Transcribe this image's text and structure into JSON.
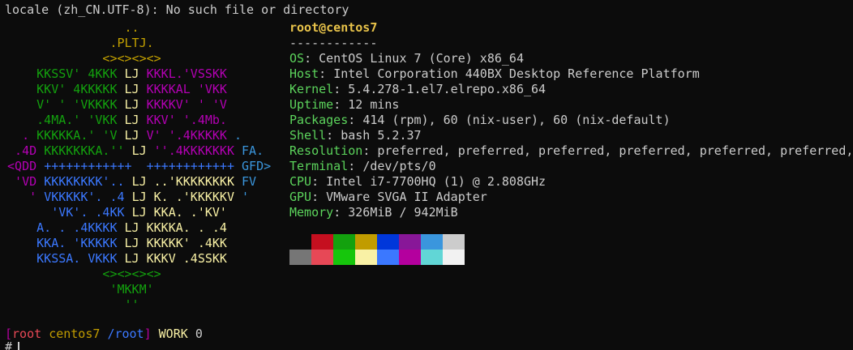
{
  "top_message": "locale (zh_CN.UTF-8): No such file or directory",
  "logo_rows": [
    [
      {
        "t": "                 ..",
        "c": "#c2a000"
      }
    ],
    [
      {
        "t": "               .PLTJ.",
        "c": "#c2a000"
      }
    ],
    [
      {
        "t": "              <><><><>",
        "c": "#c2a000"
      }
    ],
    [
      {
        "t": "     KKSSV' 4KKK ",
        "c": "#13a10e"
      },
      {
        "t": "LJ",
        "c": "#f9f1a5"
      },
      {
        "t": " KKKL.'VSSKK",
        "c": "#b400b4"
      }
    ],
    [
      {
        "t": "     KKV' 4KKKKK ",
        "c": "#13a10e"
      },
      {
        "t": "LJ",
        "c": "#f9f1a5"
      },
      {
        "t": " KKKKAL 'VKK",
        "c": "#b400b4"
      }
    ],
    [
      {
        "t": "     V' ' 'VKKKK ",
        "c": "#13a10e"
      },
      {
        "t": "LJ",
        "c": "#f9f1a5"
      },
      {
        "t": " KKKKV' ' 'V",
        "c": "#b400b4"
      }
    ],
    [
      {
        "t": "     .4MA.' 'VKK ",
        "c": "#13a10e"
      },
      {
        "t": "LJ",
        "c": "#f9f1a5"
      },
      {
        "t": " KKV' '.4Mb.",
        "c": "#b400b4"
      }
    ],
    [
      {
        "t": "   . ",
        "c": "#b400b4"
      },
      {
        "t": "KKKKKA.' 'V ",
        "c": "#13a10e"
      },
      {
        "t": "LJ",
        "c": "#f9f1a5"
      },
      {
        "t": " V' '.4KKKKK ",
        "c": "#b400b4"
      },
      {
        "t": ".",
        "c": "#3a96dd"
      }
    ],
    [
      {
        "t": "  .4D ",
        "c": "#b400b4"
      },
      {
        "t": "KKKKKKKA.'' ",
        "c": "#13a10e"
      },
      {
        "t": "LJ",
        "c": "#f9f1a5"
      },
      {
        "t": " ''.4KKKKKKK ",
        "c": "#b400b4"
      },
      {
        "t": "FA.",
        "c": "#3a96dd"
      }
    ],
    [
      {
        "t": " <QDD ",
        "c": "#b400b4"
      },
      {
        "t": "++++++++++++  ++++++++++++ ",
        "c": "#3b78ff"
      },
      {
        "t": "GFD>",
        "c": "#3a96dd"
      }
    ],
    [
      {
        "t": "  'VD ",
        "c": "#b400b4"
      },
      {
        "t": "KKKKKKKK'.. ",
        "c": "#3b78ff"
      },
      {
        "t": "LJ",
        "c": "#f9f1a5"
      },
      {
        "t": " ..'KKKKKKKK ",
        "c": "#f9f1a5"
      },
      {
        "t": "FV",
        "c": "#3a96dd"
      }
    ],
    [
      {
        "t": "    ' ",
        "c": "#b400b4"
      },
      {
        "t": "VKKKKK'. .4 ",
        "c": "#3b78ff"
      },
      {
        "t": "LJ",
        "c": "#f9f1a5"
      },
      {
        "t": " K. .'KKKKKV ",
        "c": "#f9f1a5"
      },
      {
        "t": "'",
        "c": "#3a96dd"
      }
    ],
    [
      {
        "t": "       'VK'. .4KK ",
        "c": "#3b78ff"
      },
      {
        "t": "LJ",
        "c": "#f9f1a5"
      },
      {
        "t": " KKA. .'KV'",
        "c": "#f9f1a5"
      }
    ],
    [
      {
        "t": "     A. . .4KKKK ",
        "c": "#3b78ff"
      },
      {
        "t": "LJ",
        "c": "#f9f1a5"
      },
      {
        "t": " KKKKA. . .4",
        "c": "#f9f1a5"
      }
    ],
    [
      {
        "t": "     KKA. 'KKKKK ",
        "c": "#3b78ff"
      },
      {
        "t": "LJ",
        "c": "#f9f1a5"
      },
      {
        "t": " KKKKK' .4KK",
        "c": "#f9f1a5"
      }
    ],
    [
      {
        "t": "     KKSSA. VKKK ",
        "c": "#3b78ff"
      },
      {
        "t": "LJ",
        "c": "#f9f1a5"
      },
      {
        "t": " KKKV .4SSKK",
        "c": "#f9f1a5"
      }
    ],
    [
      {
        "t": "              <><><><>",
        "c": "#13a10e"
      }
    ],
    [
      {
        "t": "               'MKKM'",
        "c": "#13a10e"
      }
    ],
    [
      {
        "t": "                 ''",
        "c": "#13a10e"
      }
    ]
  ],
  "info": {
    "title": "root@centos7",
    "separator": "------------",
    "lines": [
      {
        "key": "OS",
        "value": "CentOS Linux 7 (Core) x86_64"
      },
      {
        "key": "Host",
        "value": "Intel Corporation 440BX Desktop Reference Platform"
      },
      {
        "key": "Kernel",
        "value": "5.4.278-1.el7.elrepo.x86_64"
      },
      {
        "key": "Uptime",
        "value": "12 mins"
      },
      {
        "key": "Packages",
        "value": "414 (rpm), 60 (nix-user), 60 (nix-default)"
      },
      {
        "key": "Shell",
        "value": "bash 5.2.37"
      },
      {
        "key": "Resolution",
        "value": "preferred, preferred, preferred, preferred, preferred, preferred,"
      },
      {
        "key": "Terminal",
        "value": "/dev/pts/0"
      },
      {
        "key": "CPU",
        "value": "Intel i7-7700HQ (1) @ 2.808GHz"
      },
      {
        "key": "GPU",
        "value": "VMware SVGA II Adapter"
      },
      {
        "key": "Memory",
        "value": "326MiB / 942MiB"
      }
    ]
  },
  "palette_rows": [
    [
      "#0c0c0c",
      "#c50f1f",
      "#13a10e",
      "#c19c00",
      "#0037da",
      "#881798",
      "#3a96dd",
      "#cccccc"
    ],
    [
      "#767676",
      "#e74856",
      "#16c60c",
      "#f9f1a5",
      "#3b78ff",
      "#b4009e",
      "#61d6d6",
      "#f2f2f2"
    ]
  ],
  "prompt": {
    "open": "[",
    "user": "root",
    "host": "centos7",
    "path": "/root",
    "close": "]",
    "label": "WORK",
    "code": "0",
    "second": "#",
    "colors": {
      "bracket": "#b4009e",
      "user": "#e74856",
      "host": "#c19c00",
      "path": "#3b78ff",
      "label": "#f9f1a5"
    }
  }
}
